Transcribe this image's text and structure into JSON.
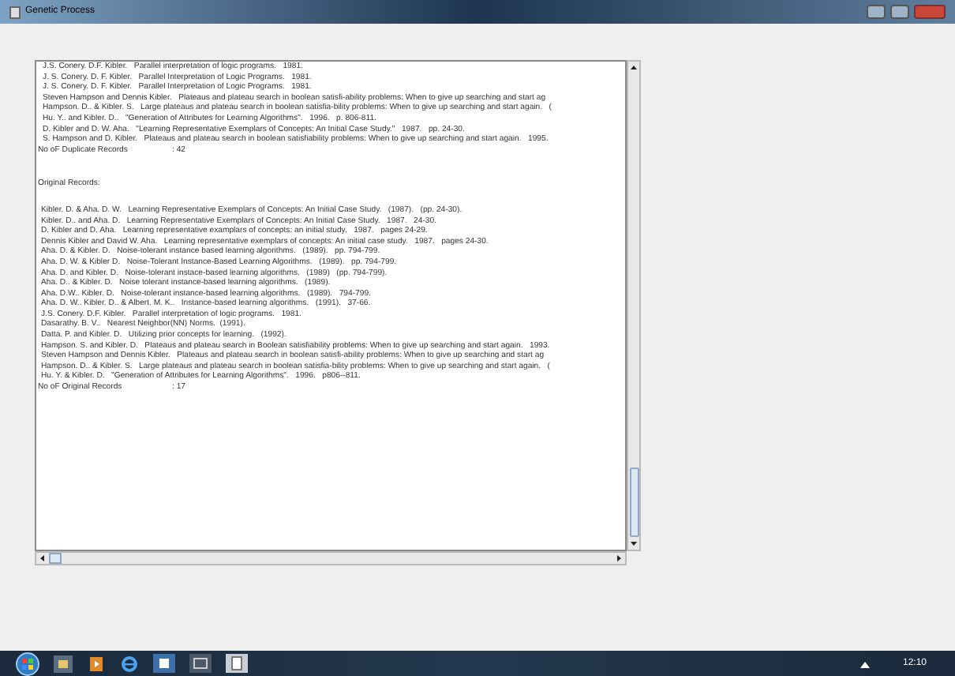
{
  "window": {
    "title": "Genetic Process"
  },
  "duplicates": {
    "lines": [
      "J.S. Conery. D.F. Kibler.   Parallel interpretation of logic programs.   1981.",
      "J. S. Conery. D. F. Kibler.   Parallel Interpretation of Logic Programs.   1981.",
      "J. S. Conery. D. F. Kibler.   Parallel Interpretation of Logic Programs.   1981.",
      "Steven Hampson and Dennis Kibler.   Plateaus and plateau search in boolean satisfi-ability problems: When to give up searching and start ag",
      "Hampson. D.. & Kibler. S.   Large plateaus and plateau search in boolean satisfia-bility problems: When to give up searching and start again.   (",
      "Hu. Y.. and Kibler. D..   \"Generation of Attributes for Learning Algorithms\".   1996.   p. 806-811.",
      "D. Kibler and D. W. Aha.   \"Learning Representative Exemplars of Concepts: An Initial Case Study.\"   1987.   pp. 24-30.",
      "S. Hampson and D. Kibler.   Plateaus and plateau search in boolean satisfiability problems: When to give up searching and start again.   1995."
    ],
    "count_label": "No oF Duplicate Records",
    "count": ": 42"
  },
  "original": {
    "heading": "Original Records:",
    "lines": [
      "Kibler. D. & Aha. D. W.   Learning Representative Exemplars of Concepts: An Initial Case Study.   (1987).   (pp. 24-30).",
      "Kibler. D.. and Aha. D.   Learning Representative Exemplars of Concepts: An Initial Case Study.   1987.   24-30.",
      "D. Kibler and D. Aha.   Learning representative examplars of concepts: an initial study.   1987.   pages 24-29.",
      "Dennis Kibler and David W. Aha.   Learning representative exemplars of concepts: An initial case study.   1987.   pages 24-30.",
      "Aha. D. & Kibler. D.   Noise-tolerant instance based learning algorithms.   (1989).   pp. 794-799.",
      "Aha. D. W. & Kibler D.   Noise-Tolerant Instance-Based Learning Algorithms.   (1989).   pp. 794-799.",
      "Aha. D. and Kibler. D.   Noise-tolerant instace-based learning algorithms.   (1989)   (pp. 794-799).",
      "Aha. D.. & Kibler. D.   Noise tolerant instance-based learning algorithms.   (1989).",
      "Aha. D.W.. Kibler. D.   Noise-tolerant instance-based learning algorithms.   (1989).   794-799.",
      "Aha. D. W.. Kibler. D.. & Albert. M. K..   Instance-based learning algorithms.   (1991).   37-66.",
      "J.S. Conery. D.F. Kibler.   Parallel interpretation of logic programs.   1981.",
      "Dasarathy. B. V..   Nearest Neighbor(NN) Norms.  (1991).",
      "Datta. P. and Kibler. D.   Utilizing prior concepts for learning.   (1992).",
      "Hampson. S. and Kibler. D.   Plateaus and plateau search in Boolean satisfiability problems: When to give up searching and start again.   1993.",
      "Steven Hampson and Dennis Kibler.   Plateaus and plateau search in boolean satisfi-ability problems: When to give up searching and start ag",
      "Hampson. D.. & Kibler. S.   Large plateaus and plateau search in boolean satisfia-bility problems: When to give up searching and start again.   (",
      "Hu. Y. & Kibler. D.   \"Generation of Attributes for Learning Algorithms\".   1996.   p806--811."
    ],
    "count_label": "No oF Original Records",
    "count": ": 17"
  },
  "taskbar": {
    "clock": "12:10"
  }
}
